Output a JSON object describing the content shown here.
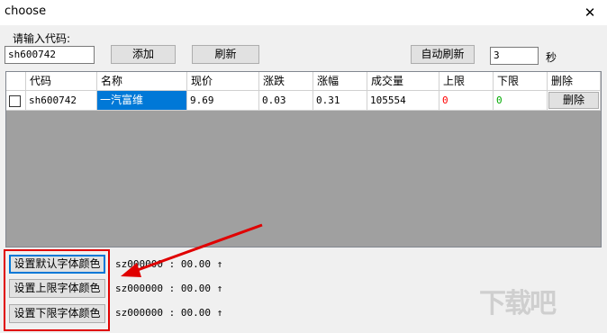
{
  "window": {
    "title": "choose",
    "close_glyph": "✕"
  },
  "form": {
    "code_label": "请输入代码:",
    "code_value": "sh600742",
    "add_label": "添加",
    "refresh_label": "刷新",
    "auto_refresh_label": "自动刷新",
    "interval_value": "3",
    "interval_unit": "秒"
  },
  "table": {
    "headers": [
      "代码",
      "名称",
      "现价",
      "涨跌",
      "涨幅",
      "成交量",
      "上限",
      "下限",
      "删除"
    ],
    "rows": [
      {
        "checked": false,
        "code": "sh600742",
        "name": "一汽富维",
        "price": "9.69",
        "change": "0.03",
        "change_pct": "0.31",
        "volume": "105554",
        "upper": "0",
        "lower": "0",
        "delete_label": "删除"
      }
    ]
  },
  "colors": {
    "upper_limit": "#ff0000",
    "lower_limit": "#00aa00",
    "highlight_box": "#e00000",
    "arrow": "#e00000"
  },
  "color_buttons": [
    {
      "label": "设置默认字体颜色",
      "status_code": "sz000000",
      "status_sep": ":",
      "status_value": "00.00",
      "status_arrow": "↑"
    },
    {
      "label": "设置上限字体颜色",
      "status_code": "sz000000",
      "status_sep": ":",
      "status_value": "00.00",
      "status_arrow": "↑"
    },
    {
      "label": "设置下限字体颜色",
      "status_code": "sz000000",
      "status_sep": ":",
      "status_value": "00.00",
      "status_arrow": "↑"
    }
  ],
  "watermark": {
    "text": "下载吧"
  }
}
